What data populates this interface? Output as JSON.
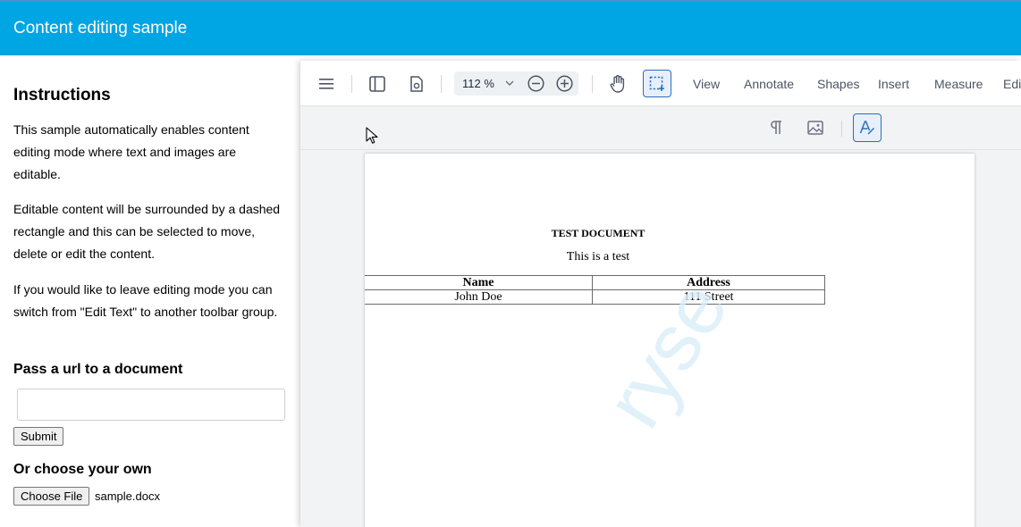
{
  "header": {
    "title": "Content editing sample"
  },
  "instructions": {
    "heading": "Instructions",
    "paragraphs": [
      "This sample automatically enables content editing mode where text and images are editable.",
      "Editable content will be surrounded by a dashed rectangle and this can be selected to move, delete or edit the content.",
      "If you would like to leave editing mode you can switch from \"Edit Text\" to another toolbar group."
    ],
    "url_heading": "Pass a url to a document",
    "url_input_value": "",
    "submit_label": "Submit",
    "choose_heading": "Or choose your own",
    "choose_file_label": "Choose File",
    "file_name": "sample.docx"
  },
  "toolbar": {
    "icons": [
      "menu-icon",
      "left-panel-icon",
      "view-controls-icon",
      "pan-hand-icon",
      "select-region-icon"
    ],
    "zoom_value": "112 %",
    "menu_items": [
      "View",
      "Annotate",
      "Shapes",
      "Insert",
      "Measure",
      "Edi"
    ],
    "selected_tool": "select-region-icon"
  },
  "edit_toolbar": {
    "icons": [
      "paragraph-icon",
      "image-icon",
      "edit-text-icon"
    ],
    "selected": "edit-text-icon"
  },
  "document": {
    "title": "TEST DOCUMENT",
    "subtitle": "This is a test",
    "table": {
      "headers": [
        "Name",
        "Address"
      ],
      "rows": [
        [
          "John Doe",
          "111 Street"
        ]
      ]
    },
    "watermark": "ryse"
  },
  "colors": {
    "header_bg": "#00a5e4",
    "accent": "#2b6dc0",
    "viewer_bg": "#f1f3f5"
  }
}
